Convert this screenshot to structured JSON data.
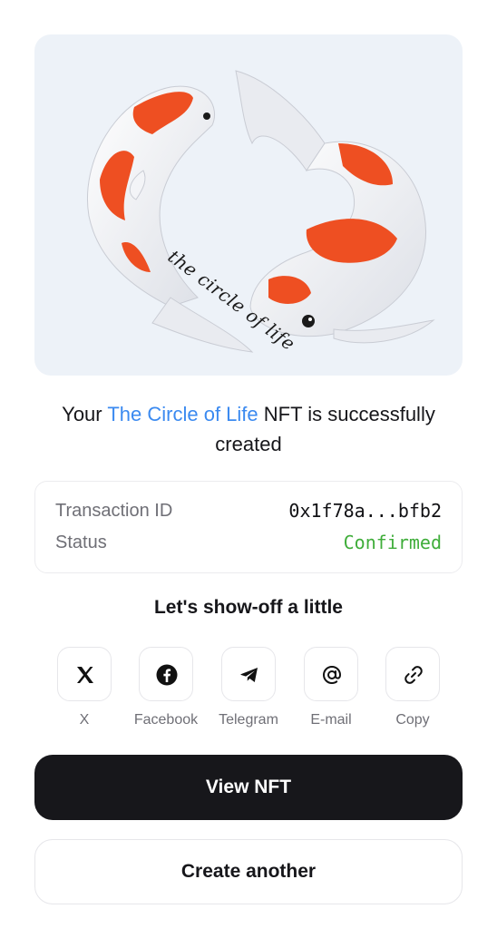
{
  "nft": {
    "image_icon": "koi-fish-yin-yang-artwork",
    "image_caption": "the circle of life"
  },
  "headline": {
    "prefix": "Your ",
    "nft_name": "The Circle of Life",
    "suffix": " NFT is successfully created"
  },
  "transaction": {
    "id_label": "Transaction ID",
    "id_value": "0x1f78a...bfb2",
    "status_label": "Status",
    "status_value": "Confirmed"
  },
  "share": {
    "title": "Let's show-off a little",
    "items": [
      {
        "label": "X",
        "icon": "x-logo-icon"
      },
      {
        "label": "Facebook",
        "icon": "facebook-icon"
      },
      {
        "label": "Telegram",
        "icon": "telegram-icon"
      },
      {
        "label": "E-mail",
        "icon": "at-sign-icon"
      },
      {
        "label": "Copy",
        "icon": "link-icon"
      }
    ]
  },
  "actions": {
    "view_label": "View NFT",
    "create_label": "Create another"
  },
  "colors": {
    "accent": "#3b8af0",
    "success": "#3fad3a",
    "primary_button": "#17171b"
  }
}
